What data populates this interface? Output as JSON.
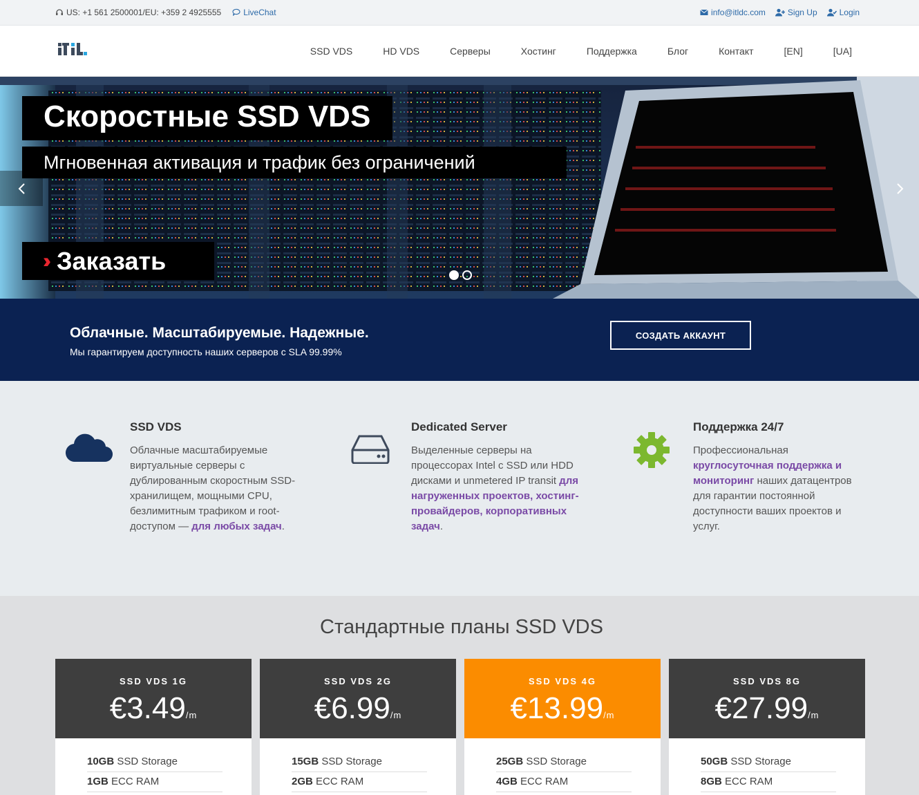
{
  "topbar": {
    "phones": "US: +1 561 2500001/EU: +359 2 4925555",
    "livechat": "LiveChat",
    "email": "info@itldc.com",
    "signup": "Sign Up",
    "login": "Login"
  },
  "nav": {
    "items": [
      "SSD VDS",
      "HD VDS",
      "Серверы",
      "Хостинг",
      "Поддержка",
      "Блог",
      "Контакт",
      "[EN]",
      "[UA]"
    ]
  },
  "hero": {
    "title": "Скоростные SSD VDS",
    "subtitle": "Мгновенная активация и трафик без ограничений",
    "order_button": "Заказать",
    "slide_active": 1,
    "slide_total": 2
  },
  "banner": {
    "title": "Облачные. Масштабируемые. Надежные.",
    "text": "Мы гарантируем доступность наших серверов с SLA 99.99%",
    "cta": "СОЗДАТЬ АККАУНТ"
  },
  "features": [
    {
      "icon": "cloud-icon",
      "title": "SSD VDS",
      "text": "Облачные масштабируемые виртуальные серверы с дублированным скоростным SSD-хранилищем, мощными CPU, безлимитным трафиком и root-доступом — ",
      "highlight": "для любых задач",
      "tail": "."
    },
    {
      "icon": "hard-drive-icon",
      "title": "Dedicated Server",
      "text": "Выделенные серверы на процессорах Intel с SSD или HDD дисками и unmetered IP transit ",
      "highlight": "для нагруженных проектов, хостинг-провайдеров, корпоративных задач",
      "tail": "."
    },
    {
      "icon": "gear-icon",
      "title": "Поддержка 24/7",
      "text_before": "Профессиональная ",
      "highlight": "круглосуточная поддержка и мониторинг",
      "text_after": " наших датацентров для гарантии постоянной доступности ваших проектов и услуг."
    }
  ],
  "plans": {
    "title": "Стандартные планы SSD VDS",
    "per": "/m",
    "items": [
      {
        "name": "SSD VDS 1G",
        "price": "€3.49",
        "storage_amount": "10GB",
        "storage_label": "SSD Storage",
        "ram_amount": "1GB",
        "ram_label": "ECC RAM",
        "featured": false
      },
      {
        "name": "SSD VDS 2G",
        "price": "€6.99",
        "storage_amount": "15GB",
        "storage_label": "SSD Storage",
        "ram_amount": "2GB",
        "ram_label": "ECC RAM",
        "featured": false
      },
      {
        "name": "SSD VDS 4G",
        "price": "€13.99",
        "storage_amount": "25GB",
        "storage_label": "SSD Storage",
        "ram_amount": "4GB",
        "ram_label": "ECC RAM",
        "featured": true
      },
      {
        "name": "SSD VDS 8G",
        "price": "€27.99",
        "storage_amount": "50GB",
        "storage_label": "SSD Storage",
        "ram_amount": "8GB",
        "ram_label": "ECC RAM",
        "featured": false
      }
    ]
  },
  "colors": {
    "banner_bg": "#0b2252",
    "accent_purple": "#7a4aa6",
    "featured_orange": "#fb8c00",
    "order_arrow_red": "#e8262f",
    "gear_green": "#7cb82f",
    "cloud_navy": "#16325f"
  }
}
